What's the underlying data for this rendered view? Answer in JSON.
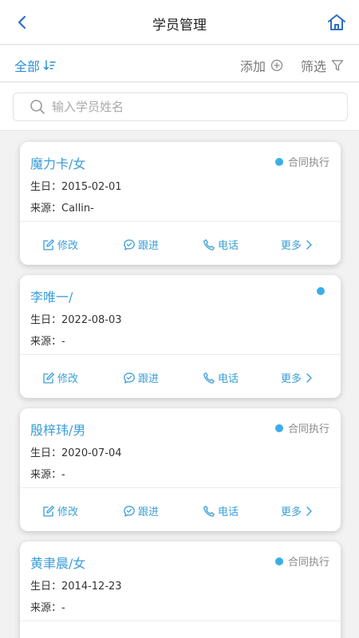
{
  "header": {
    "title": "学员管理",
    "back_icon": "chevron-left-icon",
    "home_icon": "home-icon"
  },
  "toolbar": {
    "all_label": "全部",
    "add_label": "添加",
    "filter_label": "筛选"
  },
  "search": {
    "placeholder": "输入学员姓名"
  },
  "students": [
    {
      "name": "魔力卡/女",
      "status": "合同执行",
      "birthday": "生日：2015-02-01",
      "source": "来源：Callin-"
    },
    {
      "name": "李唯一/",
      "status": "",
      "birthday": "生日：2022-08-03",
      "source": "来源：-"
    },
    {
      "name": "殷梓玮/男",
      "status": "合同执行",
      "birthday": "生日：2020-07-04",
      "source": "来源：-"
    },
    {
      "name": "黄聿晨/女",
      "status": "合同执行",
      "birthday": "生日：2014-12-23",
      "source": "来源：-"
    }
  ],
  "actions": {
    "edit": "修改",
    "follow": "跟进",
    "call": "电话",
    "more": "更多"
  },
  "colors": {
    "accent": "#2e8fd6",
    "name_blue": "#3a9ed8",
    "status_dot": "#3aaee8"
  }
}
